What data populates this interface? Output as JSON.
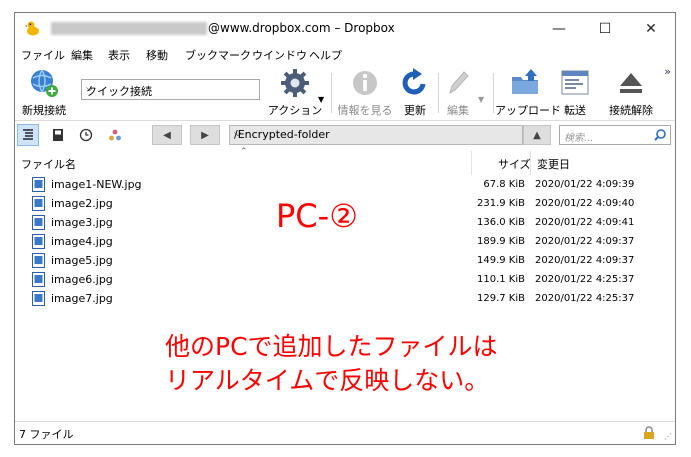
{
  "window": {
    "title": "@www.dropbox.com – Dropbox",
    "minimize": "—",
    "maximize": "☐",
    "close": "✕"
  },
  "menu": [
    "ファイル",
    "編集",
    "表示",
    "移動",
    "ブックマーク",
    "ウインドウ",
    "ヘルプ"
  ],
  "toolbar": {
    "new_connection": "新規接続",
    "quick_connect": "クイック接続",
    "action": "アクション",
    "info": "情報を見る",
    "refresh": "更新",
    "edit": "編集",
    "upload": "アップロード",
    "transfer": "転送",
    "disconnect": "接続解除",
    "more": "»"
  },
  "nav": {
    "back": "◀",
    "forward": "▶",
    "path": "/Encrypted-folder",
    "up": "▲",
    "search_placeholder": "検索..."
  },
  "columns": {
    "name": "ファイル名",
    "size": "サイズ",
    "modified": "変更日"
  },
  "files": [
    {
      "name": "image1-NEW.jpg",
      "size": "67.8 KiB",
      "date": "2020/01/22 4:09:39"
    },
    {
      "name": "image2.jpg",
      "size": "231.9 KiB",
      "date": "2020/01/22 4:09:40"
    },
    {
      "name": "image3.jpg",
      "size": "136.0 KiB",
      "date": "2020/01/22 4:09:41"
    },
    {
      "name": "image4.jpg",
      "size": "189.9 KiB",
      "date": "2020/01/22 4:09:37"
    },
    {
      "name": "image5.jpg",
      "size": "149.9 KiB",
      "date": "2020/01/22 4:09:37"
    },
    {
      "name": "image6.jpg",
      "size": "110.1 KiB",
      "date": "2020/01/22 4:25:37"
    },
    {
      "name": "image7.jpg",
      "size": "129.7 KiB",
      "date": "2020/01/22 4:25:37"
    }
  ],
  "annotation": {
    "pc_label": "PC-②",
    "message_line1": "他のPCで追加したファイルは",
    "message_line2": "リアルタイムで反映しない。"
  },
  "status": {
    "count": "7 ファイル"
  },
  "colors": {
    "annotation": "#ff0000"
  }
}
